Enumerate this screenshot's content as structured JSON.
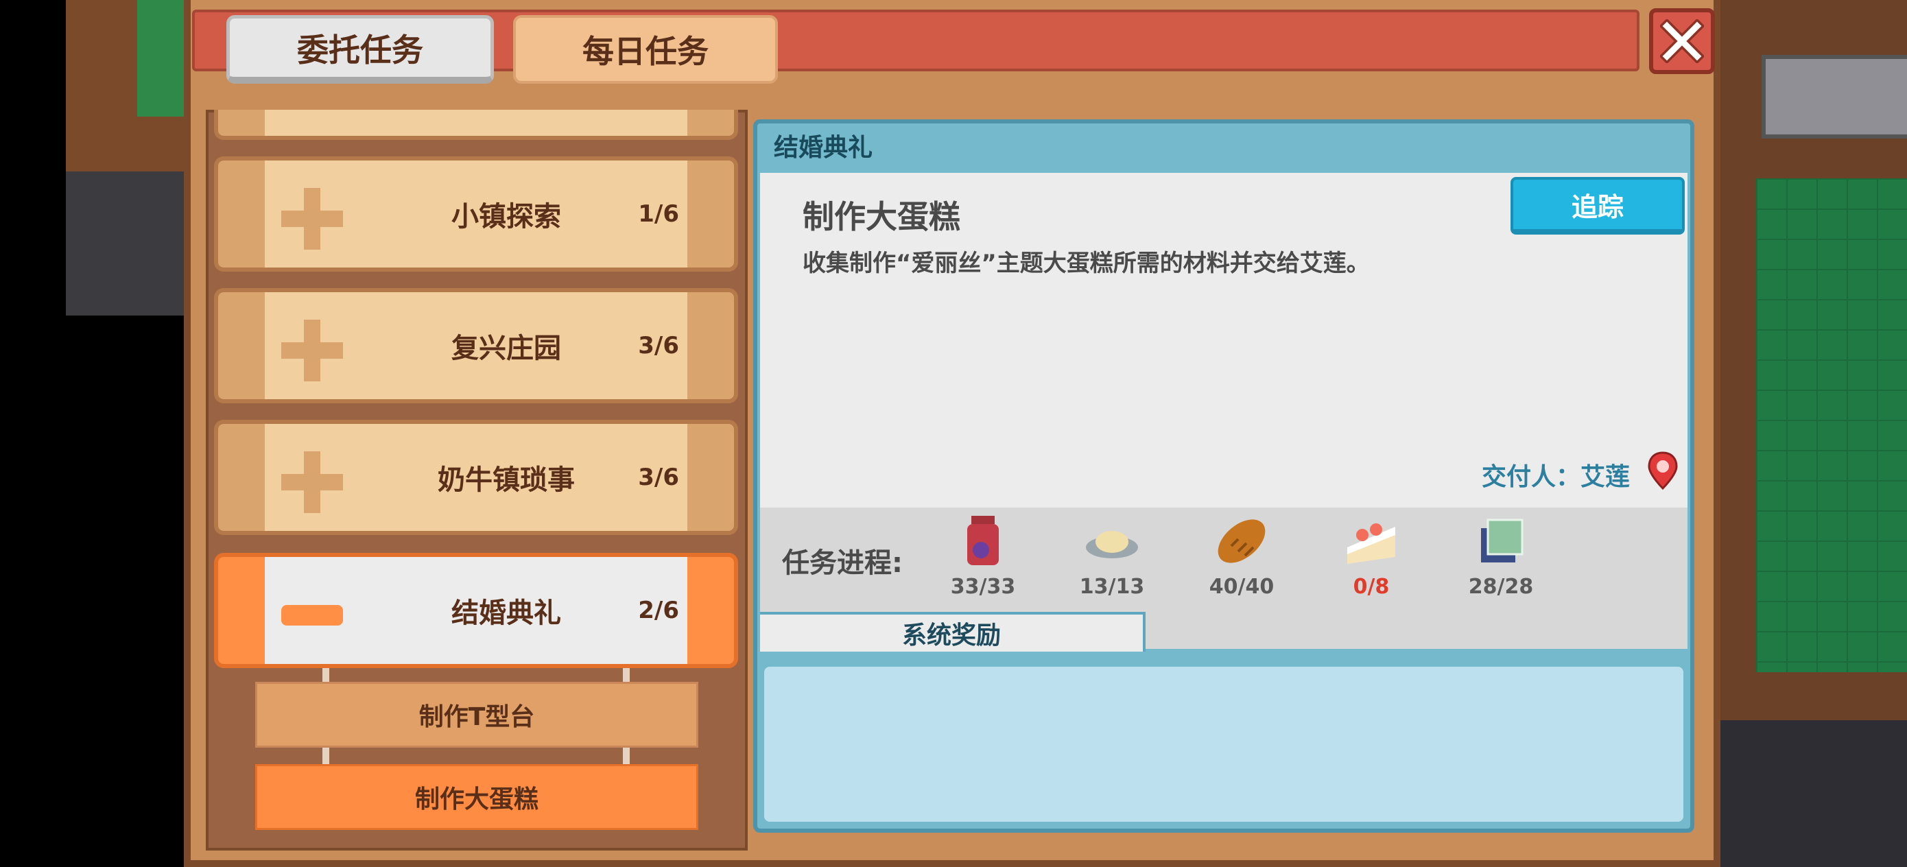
{
  "tabs": [
    {
      "label": "委托任务",
      "active": true
    },
    {
      "label": "每日任务",
      "active": false
    }
  ],
  "quest_list": [
    {
      "label": "小镇探索",
      "count": "1/6",
      "expanded": false
    },
    {
      "label": "复兴庄园",
      "count": "3/6",
      "expanded": false
    },
    {
      "label": "奶牛镇琐事",
      "count": "3/6",
      "expanded": false
    },
    {
      "label": "结婚典礼",
      "count": "2/6",
      "expanded": true
    }
  ],
  "sub_quests": [
    {
      "label": "制作T型台",
      "selected": false
    },
    {
      "label": "制作大蛋糕",
      "selected": true
    }
  ],
  "detail": {
    "section_title": "结婚典礼",
    "quest_title": "制作大蛋糕",
    "description": "收集制作“爱丽丝”主题大蛋糕所需的材料并交给艾莲。",
    "track_label": "追踪",
    "giver": "交付人：艾莲",
    "progress_label": "任务进程:",
    "items": [
      {
        "icon": "jar-icon",
        "count": "33/33",
        "complete": true
      },
      {
        "icon": "flour-plate-icon",
        "count": "13/13",
        "complete": true
      },
      {
        "icon": "bread-icon",
        "count": "40/40",
        "complete": true
      },
      {
        "icon": "cake-slice-icon",
        "count": "0/8",
        "complete": false
      },
      {
        "icon": "cloth-icon",
        "count": "28/28",
        "complete": true
      }
    ],
    "reward_tab": "系统奖励"
  },
  "colors": {
    "header_red": "#d25b47",
    "active_orange": "#ff8f45",
    "track_blue": "#22b6e0",
    "incomplete_red": "#e03c2b"
  }
}
